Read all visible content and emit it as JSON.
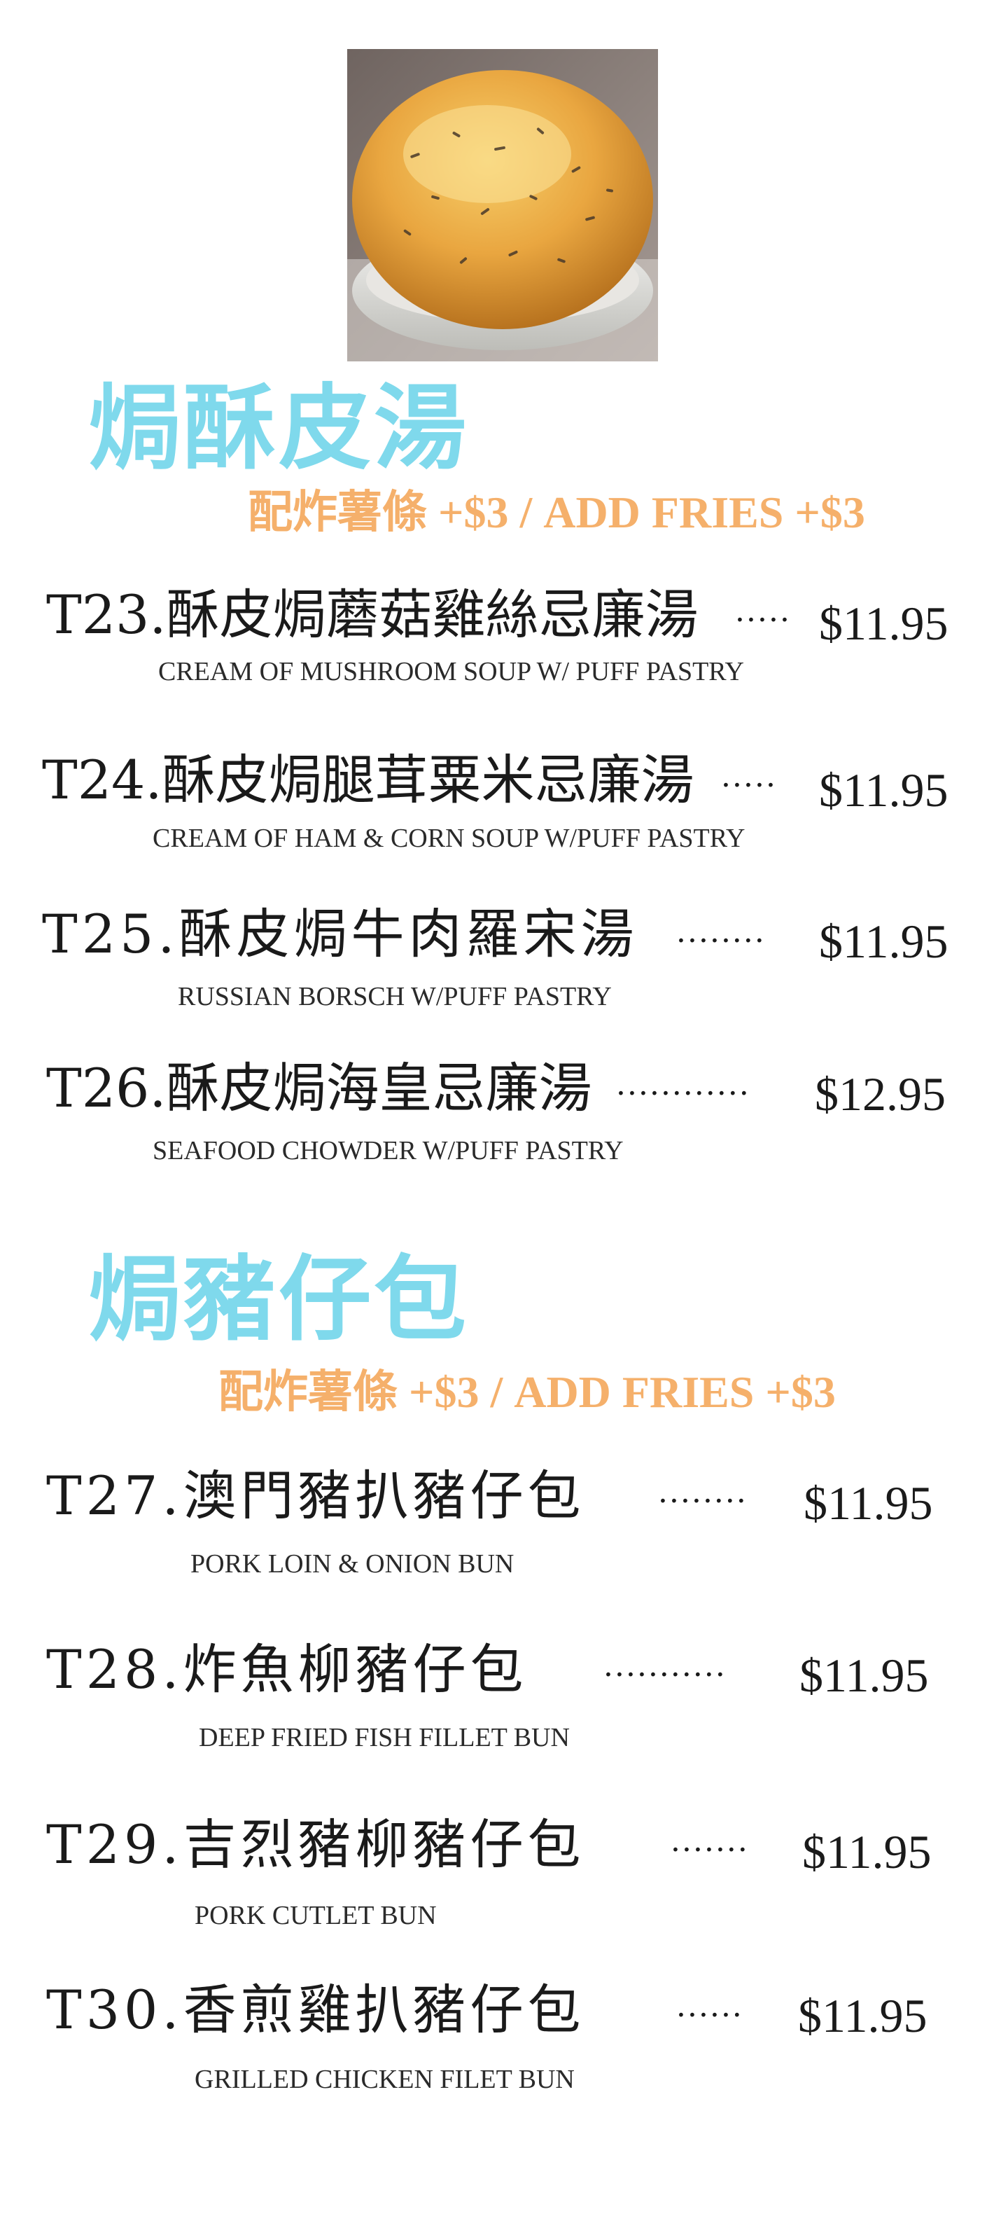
{
  "sections": [
    {
      "title": "焗酥皮湯",
      "fries_note": "配炸薯條 +$3 / ADD FRIES +$3",
      "items": [
        {
          "code": "T23.",
          "name": "酥皮焗蘑菇雞絲忌廉湯",
          "dots": "·····",
          "price": "$11.95",
          "english": "CREAM OF  MUSHROOM  SOUP W/ PUFF PASTRY"
        },
        {
          "code": "T24.",
          "name": "酥皮焗腿茸粟米忌廉湯",
          "dots": "·····",
          "price": "$11.95",
          "english": "CREAM OF HAM & CORN SOUP W/PUFF PASTRY"
        },
        {
          "code": "T25.",
          "name": "酥皮焗牛肉羅宋湯",
          "dots": "········",
          "price": "$11.95",
          "english": "RUSSIAN BORSCH W/PUFF PASTRY"
        },
        {
          "code": "T26.",
          "name": "酥皮焗海皇忌廉湯",
          "dots": "············",
          "price": "$12.95",
          "english": "SEAFOOD CHOWDER W/PUFF PASTRY"
        }
      ]
    },
    {
      "title": "焗豬仔包",
      "fries_note": "配炸薯條 +$3 / ADD FRIES +$3",
      "items": [
        {
          "code": "T27.",
          "name": "澳門豬扒豬仔包",
          "dots": "········",
          "price": "$11.95",
          "english": "PORK LOIN & ONION BUN"
        },
        {
          "code": "T28.",
          "name": "炸魚柳豬仔包",
          "dots": "···········",
          "price": "$11.95",
          "english": "DEEP FRIED FISH FILLET BUN"
        },
        {
          "code": "T29.",
          "name": "吉烈豬柳豬仔包",
          "dots": "·······",
          "price": "$11.95",
          "english": "PORK CUTLET BUN"
        },
        {
          "code": "T30.",
          "name": "香煎雞扒豬仔包",
          "dots": "······",
          "price": "$11.95",
          "english": "GRILLED CHICKEN FILET BUN"
        }
      ]
    }
  ],
  "colors": {
    "title": "#7fd9ec",
    "fries_note": "#f5b06b",
    "text": "#1a1a1a"
  }
}
